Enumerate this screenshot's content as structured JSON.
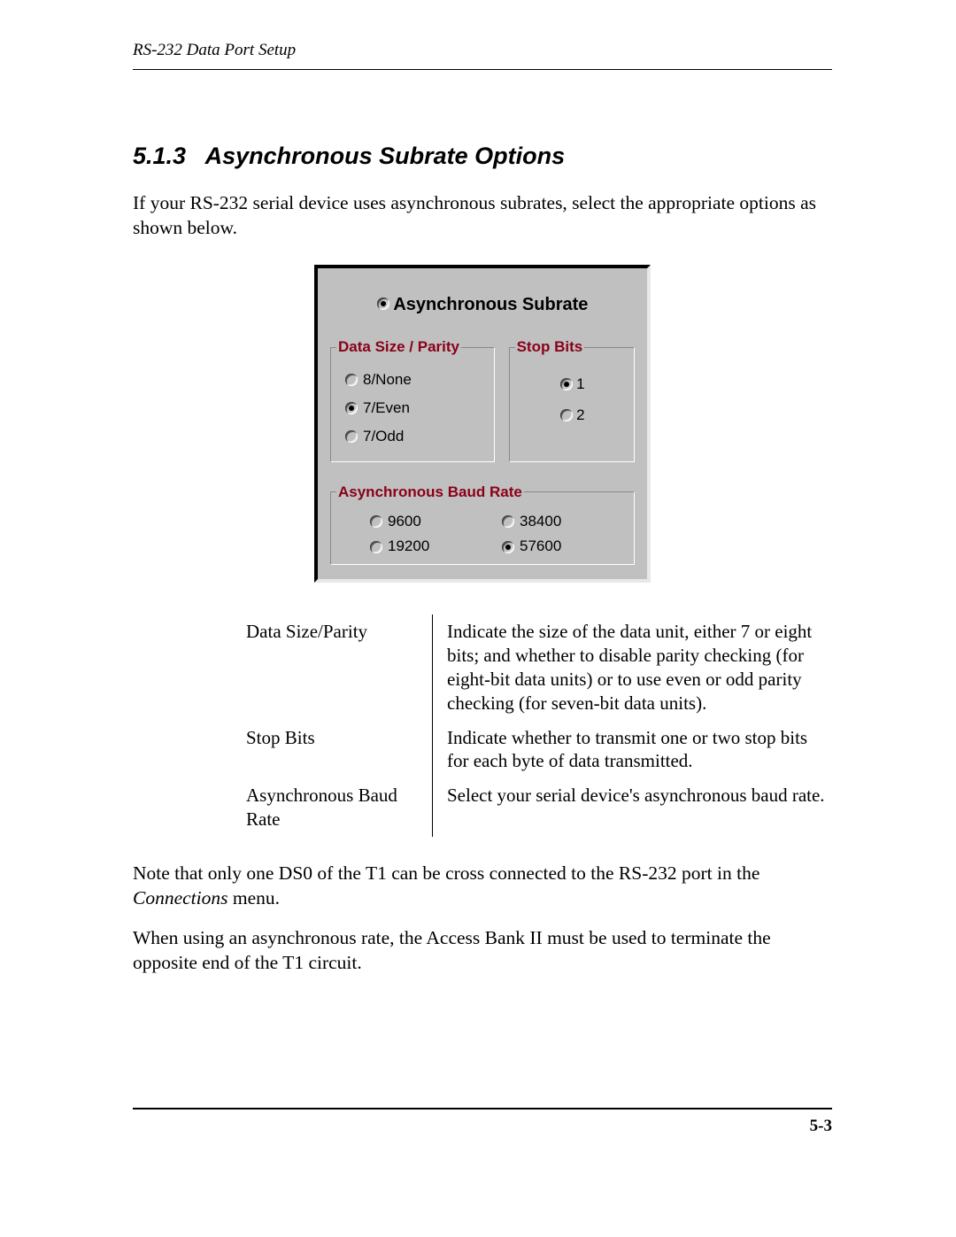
{
  "header": {
    "running_head": "RS-232 Data Port Setup"
  },
  "section": {
    "number": "5.1.3",
    "title": "Asynchronous Subrate Options"
  },
  "intro_paragraph": "If your RS-232 serial device uses asynchronous subrates, select the appropriate options as shown below.",
  "dialog": {
    "main_option": {
      "label": "Asynchronous Subrate",
      "selected": true
    },
    "groups": {
      "data_size_parity": {
        "legend": "Data Size / Parity",
        "options": [
          {
            "label": "8/None",
            "selected": false
          },
          {
            "label": "7/Even",
            "selected": true
          },
          {
            "label": "7/Odd",
            "selected": false
          }
        ]
      },
      "stop_bits": {
        "legend": "Stop Bits",
        "options": [
          {
            "label": "1",
            "selected": true
          },
          {
            "label": "2",
            "selected": false
          }
        ]
      },
      "baud_rate": {
        "legend": "Asynchronous Baud Rate",
        "options": [
          {
            "label": "9600",
            "selected": false
          },
          {
            "label": "38400",
            "selected": false
          },
          {
            "label": "19200",
            "selected": false
          },
          {
            "label": "57600",
            "selected": true
          }
        ]
      }
    }
  },
  "definitions": [
    {
      "term": "Data Size/Parity",
      "desc": "Indicate the size of the data unit, either 7 or eight bits; and whether to disable parity checking (for eight-bit data units) or to use even or odd parity checking (for seven-bit data units)."
    },
    {
      "term": "Stop Bits",
      "desc": "Indicate whether to transmit one or two stop bits for each byte of data transmitted."
    },
    {
      "term": "Asynchronous Baud Rate",
      "desc": "Select your serial device's asynchronous baud rate."
    }
  ],
  "note_paragraph": {
    "pre": "Note that only one DS0 of the T1 can be cross connected to the RS-232 port in the ",
    "italic": "Connections",
    "post": " menu."
  },
  "closing_paragraph": "When using an asynchronous rate, the Access Bank II must be used to terminate the opposite end of the T1 circuit.",
  "footer": {
    "page_number": "5-3"
  }
}
